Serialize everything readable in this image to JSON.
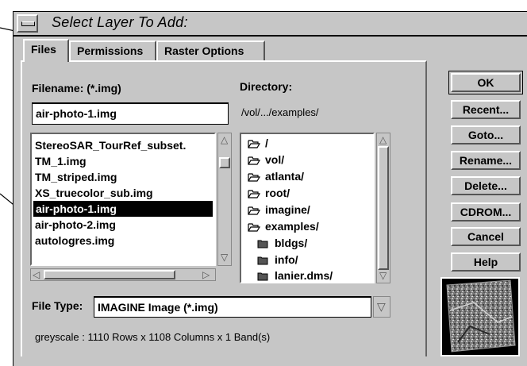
{
  "window": {
    "title": "Select Layer To Add:"
  },
  "tabs": [
    {
      "label": "Files"
    },
    {
      "label": "Permissions"
    },
    {
      "label": "Raster Options"
    }
  ],
  "filename": {
    "label": "Filename: (*.img)",
    "value": "air-photo-1.img"
  },
  "directory": {
    "label": "Directory:",
    "path": "/vol/.../examples/"
  },
  "files": [
    {
      "name": "StereoSAR_TourRef_subset."
    },
    {
      "name": "TM_1.img"
    },
    {
      "name": "TM_striped.img"
    },
    {
      "name": "XS_truecolor_sub.img"
    },
    {
      "name": "air-photo-1.img"
    },
    {
      "name": "air-photo-2.img"
    },
    {
      "name": "autologres.img"
    }
  ],
  "selected_file_index": 4,
  "dirs": [
    {
      "name": "/",
      "icon": "open-folder-icon"
    },
    {
      "name": "vol/",
      "icon": "open-folder-icon"
    },
    {
      "name": "atlanta/",
      "icon": "open-folder-icon"
    },
    {
      "name": "root/",
      "icon": "open-folder-icon"
    },
    {
      "name": "imagine/",
      "icon": "open-folder-icon"
    },
    {
      "name": "examples/",
      "icon": "open-folder-icon"
    },
    {
      "name": "bldgs/",
      "icon": "closed-folder-icon"
    },
    {
      "name": "info/",
      "icon": "closed-folder-icon"
    },
    {
      "name": "lanier.dms/",
      "icon": "closed-folder-icon"
    }
  ],
  "filetype": {
    "label": "File Type:",
    "value": "IMAGINE Image (*.img)"
  },
  "info": "greyscale : 1110 Rows x 1108 Columns x 1 Band(s)",
  "buttons": {
    "ok": "OK",
    "recent": "Recent...",
    "goto": "Goto...",
    "rename": "Rename...",
    "delete": "Delete...",
    "cdrom": "CDROM...",
    "cancel": "Cancel",
    "help": "Help"
  }
}
